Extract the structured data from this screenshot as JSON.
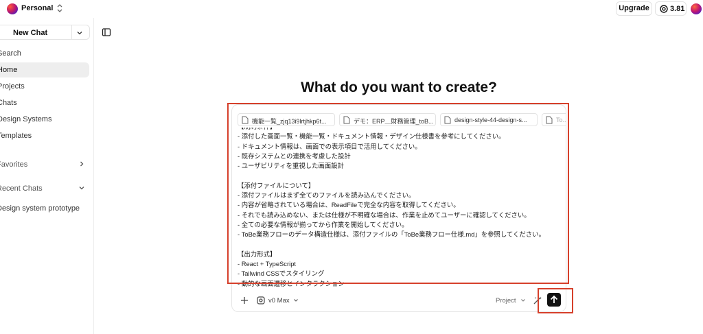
{
  "workspace": {
    "name": "Personal"
  },
  "header": {
    "upgrade_label": "Upgrade",
    "credits": "3.81"
  },
  "sidebar": {
    "new_chat_label": "New Chat",
    "nav": [
      {
        "label": "Search"
      },
      {
        "label": "Home"
      },
      {
        "label": "Projects"
      },
      {
        "label": "Chats"
      },
      {
        "label": "Design Systems"
      },
      {
        "label": "Templates"
      }
    ],
    "favorites_label": "Favorites",
    "recent_label": "Recent Chats",
    "recent": [
      {
        "label": "Design system prototype"
      }
    ]
  },
  "main": {
    "heading": "What do you want to create?"
  },
  "composer": {
    "attachments": [
      {
        "label": "機能一覧_zjq13i9lrtjhkp6t..."
      },
      {
        "label": "デモ：ERP＿財務管理_toB..."
      },
      {
        "label": "design-style-44-design-s..."
      },
      {
        "label": "To..."
      }
    ],
    "prompt": "【制約条件】\n- 添付した画面一覧・機能一覧・ドキュメント情報・デザイン仕様書を参考にしてください。\n- ドキュメント情報は、画面での表示項目で活用してください。\n- 既存システムとの連携を考慮した設計\n- ユーザビリティを重視した画面設計\n\n【添付ファイルについて】\n- 添付ファイルはまず全てのファイルを読み込んでください。\n- 内容が省略されている場合は、ReadFileで完全な内容を取得してください。\n- それでも読み込めない、または仕様が不明確な場合は、作業を止めてユーザーに確認してください。\n- 全ての必要な情報が揃ってから作業を開始してください。\n- ToBe業務フローのデータ構造仕様は、添付ファイルの「ToBe業務フロー仕様.md」を参照してください。\n\n【出力形式】\n- React + TypeScript\n- Tailwind CSSでスタイリング\n- 動的な画面遷移とインタラクション",
    "model_label": "v0 Max",
    "project_label": "Project"
  },
  "colors": {
    "highlight": "#d6402b",
    "send_button": "#111111",
    "active_nav_bg": "#eeeeee"
  }
}
